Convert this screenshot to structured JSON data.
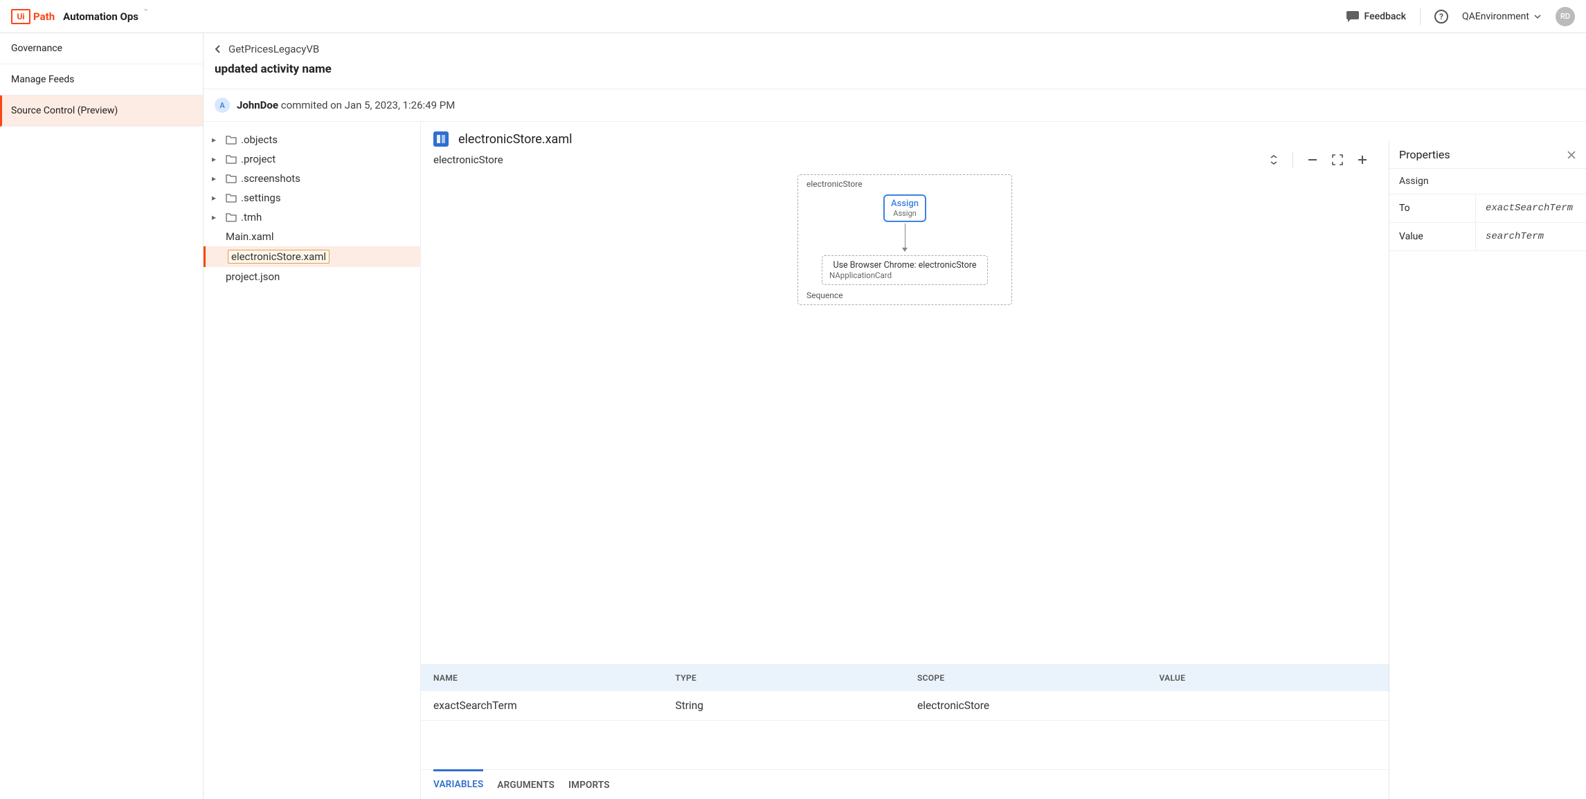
{
  "header": {
    "logo_ui": "Ui",
    "logo_path": "Path",
    "product": "Automation Ops",
    "tm": "™",
    "feedback": "Feedback",
    "environment": "QAEnvironment",
    "avatar_initials": "RD"
  },
  "sidebar": {
    "items": [
      {
        "label": "Governance"
      },
      {
        "label": "Manage Feeds"
      },
      {
        "label": "Source Control (Preview)"
      }
    ]
  },
  "breadcrumb": {
    "back_target": "GetPricesLegacyVB"
  },
  "page_title": "updated activity name",
  "commit": {
    "avatar_letter": "A",
    "author": "JohnDoe",
    "rest": "commited on Jan 5, 2023, 1:26:49 PM"
  },
  "tree": {
    "folders": [
      {
        "name": ".objects"
      },
      {
        "name": ".project"
      },
      {
        "name": ".screenshots"
      },
      {
        "name": ".settings"
      },
      {
        "name": ".tmh"
      }
    ],
    "files": [
      {
        "name": "Main.xaml"
      },
      {
        "name": "electronicStore.xaml"
      },
      {
        "name": "project.json"
      }
    ]
  },
  "canvas": {
    "filename": "electronicStore.xaml",
    "workflow_name": "electronicStore",
    "sequence_label_top": "electronicStore",
    "sequence_label_bottom": "Sequence",
    "assign_title": "Assign",
    "assign_sub": "Assign",
    "browser_title": "Use Browser Chrome: electronicStore",
    "browser_sub": "NApplicationCard"
  },
  "vars_table": {
    "headers": {
      "name": "NAME",
      "type": "TYPE",
      "scope": "SCOPE",
      "value": "VALUE"
    },
    "rows": [
      {
        "name": "exactSearchTerm",
        "type": "String",
        "scope": "electronicStore",
        "value": ""
      }
    ]
  },
  "bottom_tabs": {
    "variables": "VARIABLES",
    "arguments": "ARGUMENTS",
    "imports": "IMPORTS"
  },
  "properties": {
    "title": "Properties",
    "section": "Assign",
    "rows": [
      {
        "key": "To",
        "value": "exactSearchTerm"
      },
      {
        "key": "Value",
        "value": "searchTerm"
      }
    ]
  }
}
